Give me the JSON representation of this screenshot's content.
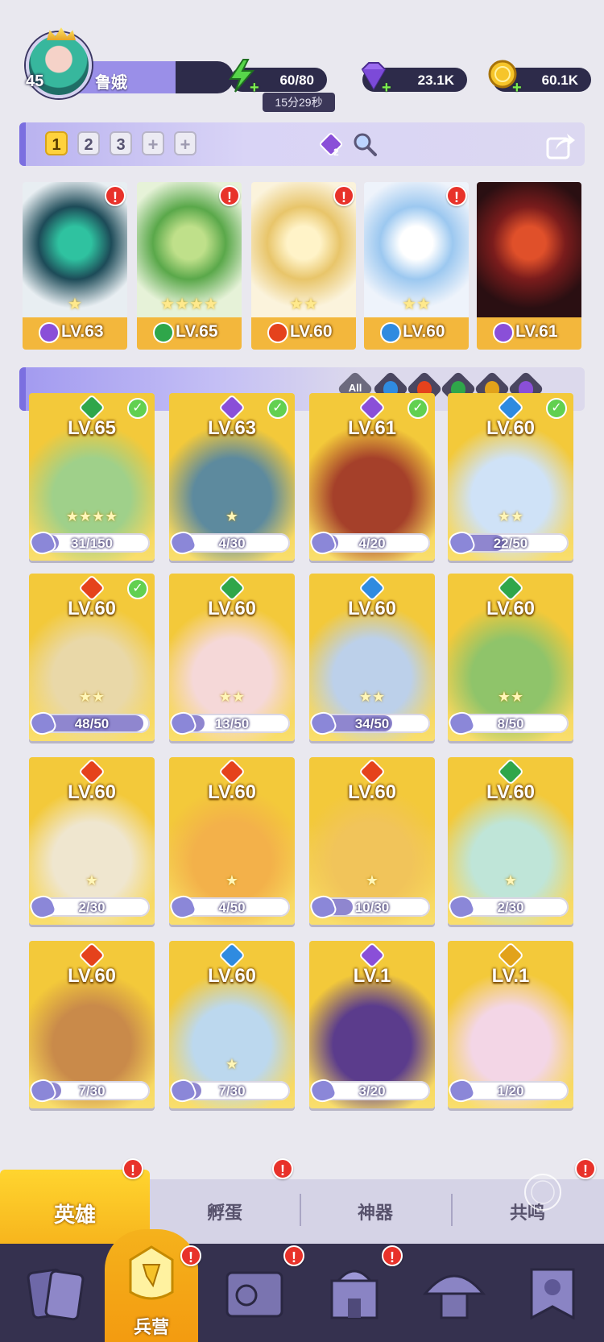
{
  "player": {
    "level": "45",
    "name": "鲁娥"
  },
  "resources": {
    "stamina": "60/80",
    "stamina_timer": "15分29秒",
    "gems": "23.1K",
    "coins": "60.1K"
  },
  "teams": {
    "slots": [
      "1",
      "2",
      "3",
      "+",
      "+"
    ],
    "active_index": 0,
    "buff_count": "2"
  },
  "team_heroes": [
    {
      "level": "LV.63",
      "element": "dark",
      "stars": "★",
      "alert": "!"
    },
    {
      "level": "LV.65",
      "element": "nature",
      "stars": "★★★★",
      "alert": "!"
    },
    {
      "level": "LV.60",
      "element": "fire",
      "stars": "★★",
      "alert": "!"
    },
    {
      "level": "LV.60",
      "element": "water",
      "stars": "★★",
      "alert": "!"
    },
    {
      "level": "LV.61",
      "element": "dark",
      "stars": "",
      "alert": ""
    }
  ],
  "filters": {
    "all_label": "All",
    "elements": [
      "water",
      "fire",
      "nature",
      "light",
      "dark"
    ]
  },
  "element_colors": {
    "water": "#2f8be0",
    "fire": "#e5421c",
    "nature": "#2fa64a",
    "light": "#e2a21a",
    "dark": "#8a4fd8"
  },
  "heroes": [
    {
      "level": "LV.65",
      "element": "nature",
      "check": true,
      "shards": "31/150",
      "progress": 0.21,
      "stars": "★★★★"
    },
    {
      "level": "LV.63",
      "element": "dark",
      "check": true,
      "shards": "4/30",
      "progress": 0.13,
      "stars": "★"
    },
    {
      "level": "LV.61",
      "element": "dark",
      "check": true,
      "shards": "4/20",
      "progress": 0.2,
      "stars": ""
    },
    {
      "level": "LV.60",
      "element": "water",
      "check": true,
      "shards": "22/50",
      "progress": 0.44,
      "stars": "★★"
    },
    {
      "level": "LV.60",
      "element": "fire",
      "check": true,
      "shards": "48/50",
      "progress": 0.96,
      "stars": "★★"
    },
    {
      "level": "LV.60",
      "element": "nature",
      "check": false,
      "shards": "13/50",
      "progress": 0.26,
      "stars": "★★"
    },
    {
      "level": "LV.60",
      "element": "water",
      "check": false,
      "shards": "34/50",
      "progress": 0.68,
      "stars": "★★"
    },
    {
      "level": "LV.60",
      "element": "nature",
      "check": false,
      "shards": "8/50",
      "progress": 0.16,
      "stars": "★★"
    },
    {
      "level": "LV.60",
      "element": "fire",
      "check": false,
      "shards": "2/30",
      "progress": 0.07,
      "stars": "★"
    },
    {
      "level": "LV.60",
      "element": "fire",
      "check": false,
      "shards": "4/50",
      "progress": 0.08,
      "stars": "★"
    },
    {
      "level": "LV.60",
      "element": "fire",
      "check": false,
      "shards": "10/30",
      "progress": 0.33,
      "stars": "★"
    },
    {
      "level": "LV.60",
      "element": "nature",
      "check": false,
      "shards": "2/30",
      "progress": 0.07,
      "stars": "★"
    },
    {
      "level": "LV.60",
      "element": "fire",
      "check": false,
      "shards": "7/30",
      "progress": 0.23,
      "stars": ""
    },
    {
      "level": "LV.60",
      "element": "water",
      "check": false,
      "shards": "7/30",
      "progress": 0.23,
      "stars": "★"
    },
    {
      "level": "LV.1",
      "element": "dark",
      "check": false,
      "shards": "3/20",
      "progress": 0.15,
      "stars": ""
    },
    {
      "level": "LV.1",
      "element": "light",
      "check": false,
      "shards": "1/20",
      "progress": 0.05,
      "stars": ""
    }
  ],
  "subtabs": [
    {
      "label": "英雄",
      "active": true,
      "alert": "!"
    },
    {
      "label": "孵蛋",
      "active": false,
      "alert": "!"
    },
    {
      "label": "神器",
      "active": false,
      "alert": ""
    },
    {
      "label": "共鸣",
      "active": false,
      "alert": "!"
    }
  ],
  "bottom_nav": [
    {
      "icon": "cards-icon",
      "label": "",
      "alert": ""
    },
    {
      "icon": "barracks-icon",
      "label": "兵营",
      "alert": "!",
      "active": true
    },
    {
      "icon": "map-icon",
      "label": "",
      "alert": "!"
    },
    {
      "icon": "castle-icon",
      "label": "",
      "alert": "!"
    },
    {
      "icon": "mushroom-house-icon",
      "label": "",
      "alert": ""
    },
    {
      "icon": "guild-banner-icon",
      "label": "",
      "alert": ""
    }
  ]
}
